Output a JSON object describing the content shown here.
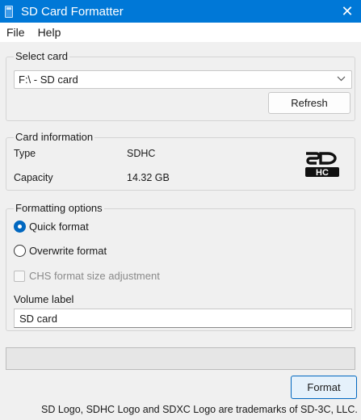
{
  "window": {
    "title": "SD Card Formatter",
    "close_glyph": "✕"
  },
  "menu": [
    "File",
    "Help"
  ],
  "select_card": {
    "title": "Select card",
    "selected": "F:\\ - SD card",
    "refresh_label": "Refresh"
  },
  "card_info": {
    "title": "Card information",
    "type_label": "Type",
    "type_value": "SDHC",
    "capacity_label": "Capacity",
    "capacity_value": "14.32 GB",
    "logo_text": "SDHC"
  },
  "formatting": {
    "title": "Formatting options",
    "quick_format": "Quick format",
    "overwrite_format": "Overwrite format",
    "selected_option": "Quick format",
    "chs_label": "CHS format size adjustment",
    "chs_checked": false,
    "chs_enabled": false,
    "volume_label_title": "Volume label",
    "volume_label_value": "SD card"
  },
  "progress": {
    "fraction": 0
  },
  "format_label": "Format",
  "footer": "SD Logo, SDHC Logo and SDXC Logo are trademarks of SD-3C, LLC."
}
